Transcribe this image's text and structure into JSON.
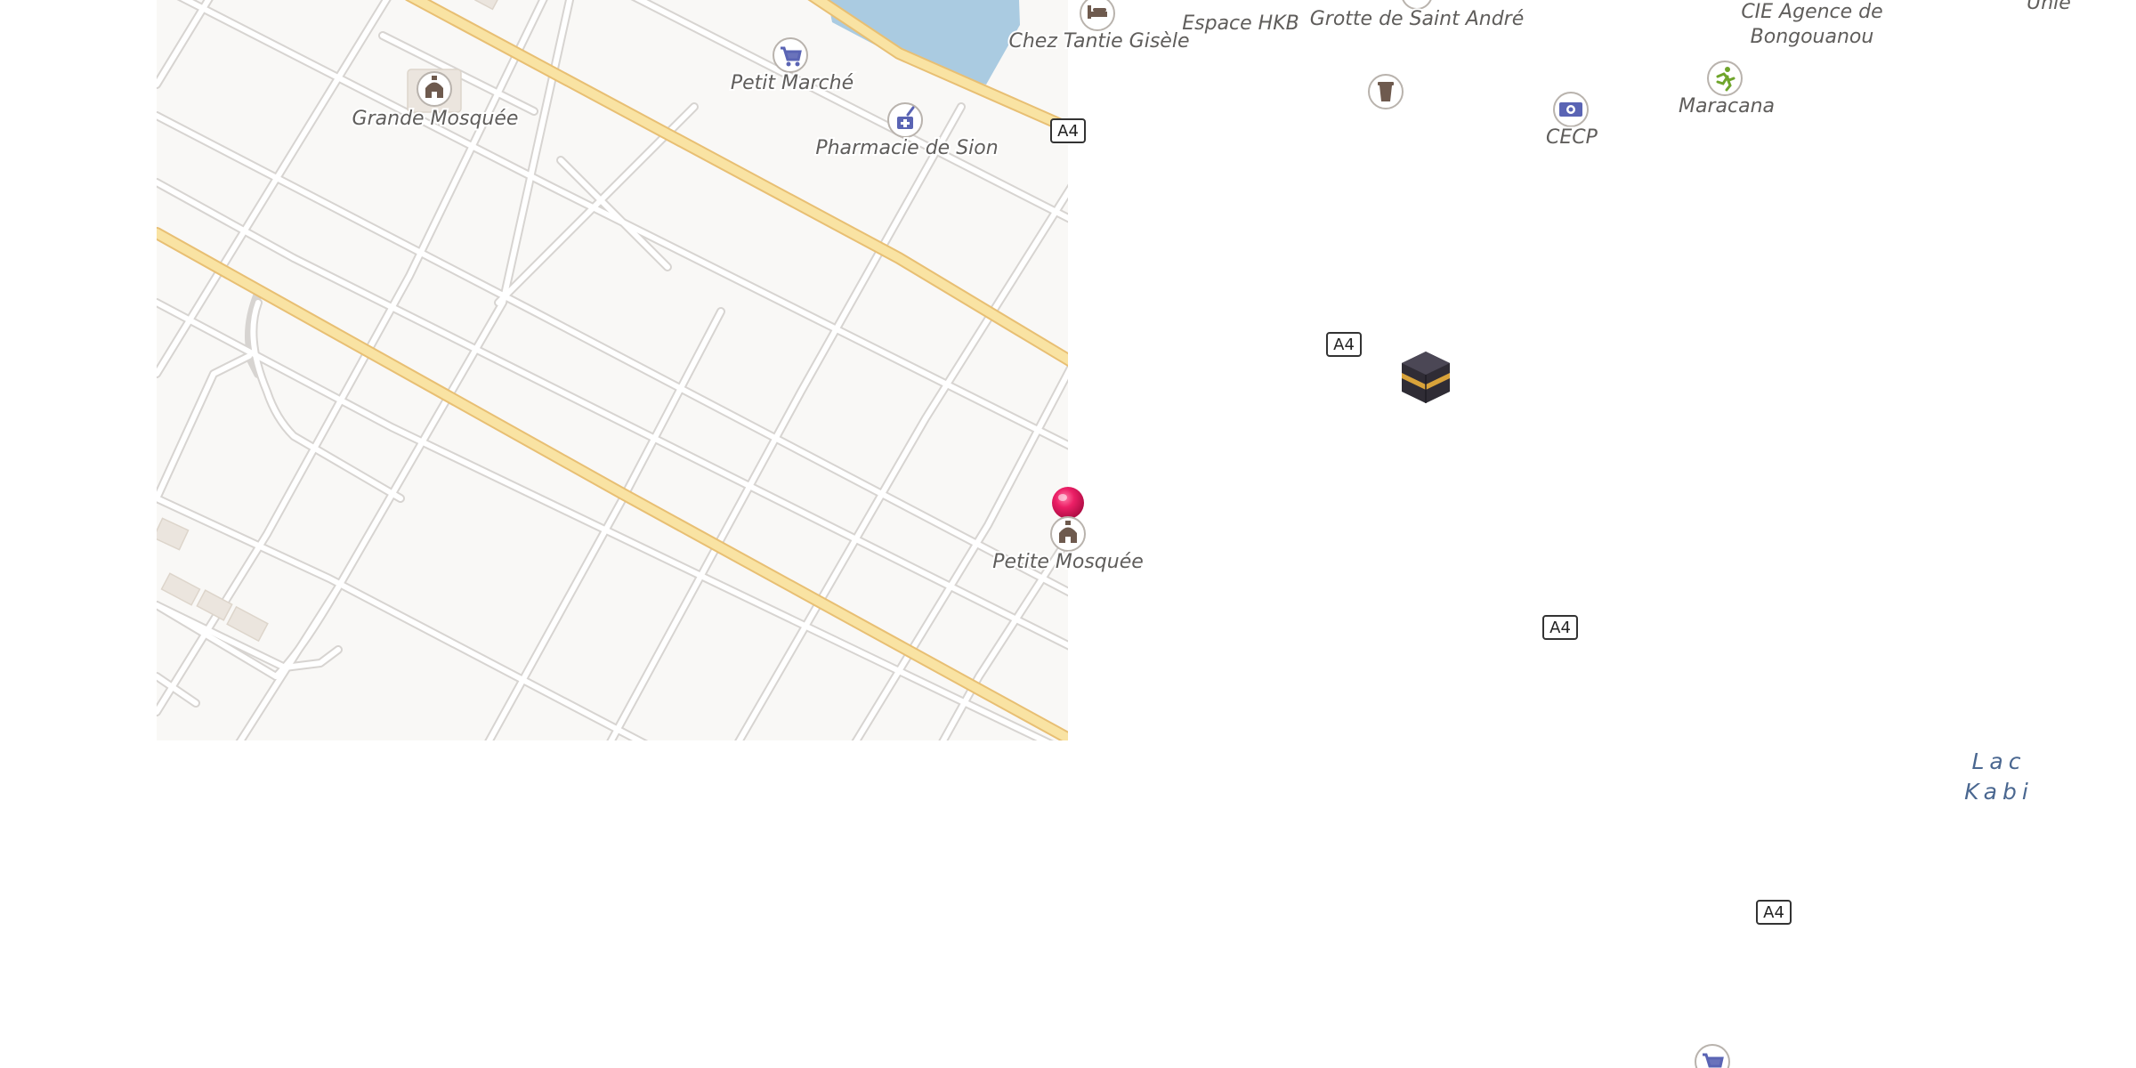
{
  "map": {
    "pois": [
      {
        "id": "chez-tantie-gisele",
        "label": "Chez Tantie Gisèle",
        "icon": "bed-icon",
        "icon_color": "#6e5a4e"
      },
      {
        "id": "espace-hkb",
        "label": "Espace HKB",
        "icon": ""
      },
      {
        "id": "grotte-de-saint-andre",
        "label": "Grotte de Saint André",
        "icon": ""
      },
      {
        "id": "cie-agence",
        "label_line1": "CIE Agence de",
        "label_line2": "Bongouanou",
        "icon": ""
      },
      {
        "id": "unie",
        "label": "Unie",
        "icon": ""
      },
      {
        "id": "petit-marche",
        "label": "Petit Marché",
        "icon": "shopping-cart-icon",
        "icon_color": "#5a64b4"
      },
      {
        "id": "grande-mosquee",
        "label": "Grande Mosquée",
        "icon": "mosque-icon",
        "icon_color": "#6e5a4e"
      },
      {
        "id": "pharmacie-de-sion",
        "label": "Pharmacie de Sion",
        "icon": "pharmacy-icon",
        "icon_color": "#5a64b4"
      },
      {
        "id": "cecp",
        "label": "CECP",
        "icon": "banknote-icon",
        "icon_color": "#5a64b4"
      },
      {
        "id": "maracana",
        "label": "Maracana",
        "icon": "sports-runner-icon",
        "icon_color": "#6fa52b"
      },
      {
        "id": "petite-mosquee",
        "label": "Petite Mosquée",
        "icon": "mosque-icon",
        "icon_color": "#6e5a4e"
      }
    ],
    "unlabeled_icons": [
      {
        "id": "waste-basket",
        "icon": "waste-basket-icon"
      },
      {
        "id": "kaaba",
        "icon": "kaaba-icon"
      },
      {
        "id": "shop-bottom",
        "icon": "shopping-cart-icon"
      }
    ],
    "water_label_line1": "Lac",
    "water_label_line2": "Kabi",
    "road_ref": "A4",
    "marker": {
      "icon": "map-pin-icon",
      "color": "#e8175d"
    },
    "colors": {
      "road_primary": "#f9e3a3",
      "water": "#aacbe1",
      "land": "#f9f8f6"
    }
  }
}
